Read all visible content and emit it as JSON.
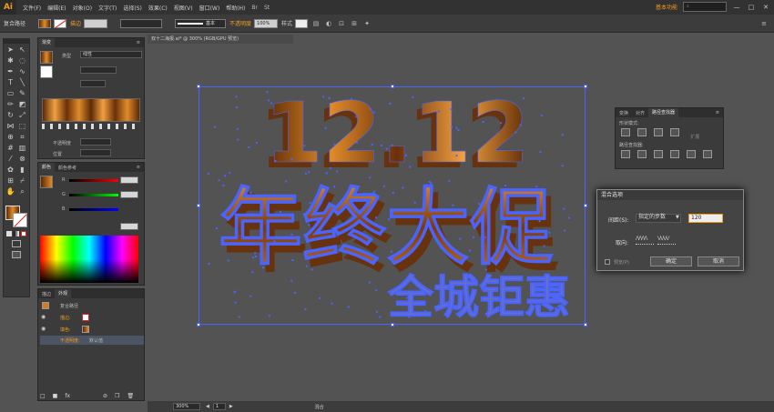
{
  "app": {
    "logo": "Ai"
  },
  "menu": {
    "items": [
      "文件(F)",
      "编辑(E)",
      "对象(O)",
      "文字(T)",
      "选择(S)",
      "效果(C)",
      "视图(V)",
      "窗口(W)",
      "帮助(H)"
    ],
    "workspace": "基本功能",
    "search_placeholder": "",
    "win_min": "—",
    "win_max": "□",
    "win_close": "✕"
  },
  "control": {
    "selection_label": "复合路径",
    "stroke_label": "描边",
    "brush_label": "基本",
    "opacity_label": "不透明度",
    "opacity_value": "100%",
    "style_label": "样式"
  },
  "document": {
    "tab_title": "双十二海报.ai* @ 300% (RGB/GPU 预览)"
  },
  "gradient_panel": {
    "tab": "渐变",
    "type_label": "类型",
    "type_value": "线性",
    "angle_label": "",
    "opacity_label": "不透明度",
    "position_label": "位置"
  },
  "color_panel": {
    "tab1": "颜色",
    "tab2": "颜色参考",
    "r": "R",
    "g": "G",
    "b": "B"
  },
  "appearance_panel": {
    "tab1": "描边",
    "tab2": "外观",
    "header": "复合路径",
    "stroke_label": "描边:",
    "fill_label": "填色:",
    "opacity_label": "不透明度:",
    "opacity_value": "默认值"
  },
  "pathfinder_panel": {
    "tabs": [
      "变换",
      "对齐",
      "路径查找器"
    ],
    "shape_modes_label": "形状模式:",
    "pathfinders_label": "路径查找器:",
    "expand_label": "扩展"
  },
  "blend_dialog": {
    "title": "混合选项",
    "spacing_label": "间距(S):",
    "spacing_value": "指定的步数",
    "steps_value": "120",
    "orientation_label": "取向:",
    "preview_label": "预览(P)",
    "ok_label": "确定",
    "cancel_label": "取消"
  },
  "status": {
    "zoom": "300%",
    "page": "1",
    "tool": "混合"
  },
  "artwork": {
    "line1": "12.12",
    "line2": "年终大促",
    "line3": "全城钜惠"
  },
  "colors": {
    "accent": "#f29b1d",
    "selection": "#4a64ff",
    "gradient_dark": "#5c2a05",
    "gradient_light": "#e08b2a"
  }
}
